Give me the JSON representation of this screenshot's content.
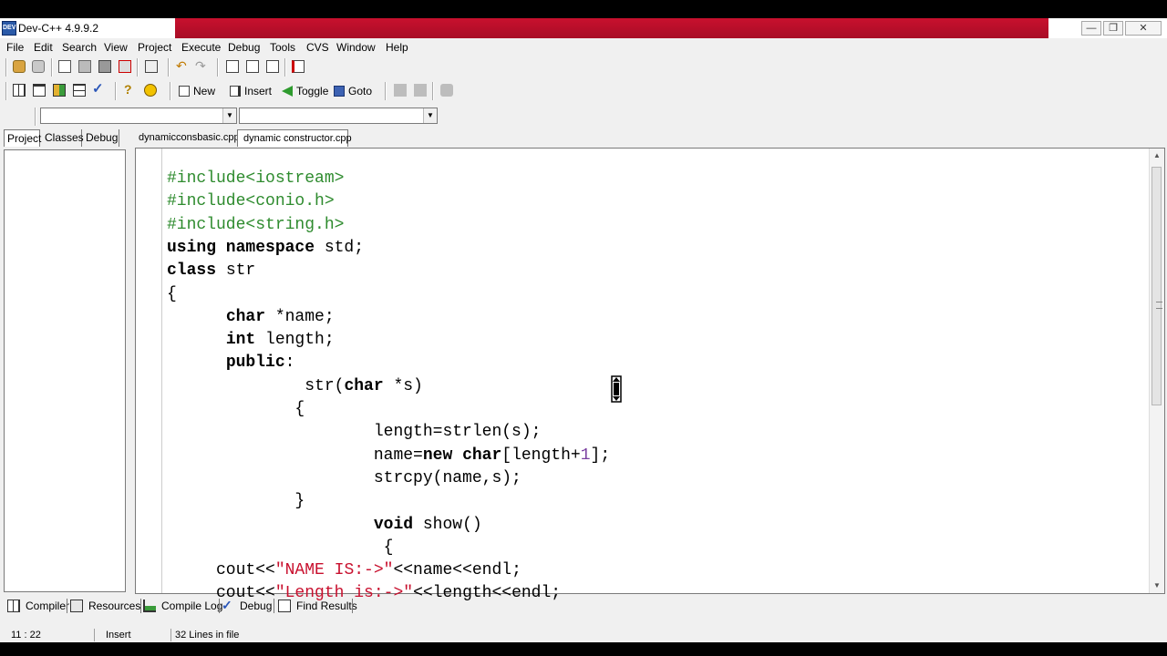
{
  "window": {
    "title": "Dev-C++ 4.9.9.2",
    "app_icon_text": "DEV"
  },
  "menu": [
    "File",
    "Edit",
    "Search",
    "View",
    "Project",
    "Execute",
    "Debug",
    "Tools",
    "CVS",
    "Window",
    "Help"
  ],
  "toolbar2": {
    "new_label": "New",
    "insert_label": "Insert",
    "toggle_label": "Toggle",
    "goto_label": "Goto"
  },
  "side_tabs": [
    "Project",
    "Classes",
    "Debug"
  ],
  "file_tabs": [
    "dynamicconsbasic.cpp",
    "dynamic constructor.cpp"
  ],
  "code_lines": [
    [
      {
        "t": "#include<iostream>",
        "c": "pp"
      }
    ],
    [
      {
        "t": "#include<conio.h>",
        "c": "pp"
      }
    ],
    [
      {
        "t": "#include<string.h>",
        "c": "pp"
      }
    ],
    [
      {
        "t": "using namespace",
        "c": "kw"
      },
      {
        "t": " std;",
        "c": ""
      }
    ],
    [
      {
        "t": "class",
        "c": "kw"
      },
      {
        "t": " str",
        "c": ""
      }
    ],
    [
      {
        "t": "{",
        "c": ""
      }
    ],
    [
      {
        "t": "      ",
        "c": ""
      },
      {
        "t": "char",
        "c": "kw"
      },
      {
        "t": " *name;",
        "c": ""
      }
    ],
    [
      {
        "t": "      ",
        "c": ""
      },
      {
        "t": "int",
        "c": "kw"
      },
      {
        "t": " length;",
        "c": ""
      }
    ],
    [
      {
        "t": "      ",
        "c": ""
      },
      {
        "t": "public",
        "c": "kw"
      },
      {
        "t": ":",
        "c": ""
      }
    ],
    [
      {
        "t": "              str(",
        "c": ""
      },
      {
        "t": "char",
        "c": "kw"
      },
      {
        "t": " *s)",
        "c": ""
      }
    ],
    [
      {
        "t": "             {",
        "c": ""
      }
    ],
    [
      {
        "t": "                     length=strlen(s);",
        "c": ""
      }
    ],
    [
      {
        "t": "                     name=",
        "c": ""
      },
      {
        "t": "new char",
        "c": "kw"
      },
      {
        "t": "[length+",
        "c": ""
      },
      {
        "t": "1",
        "c": "num"
      },
      {
        "t": "];",
        "c": ""
      }
    ],
    [
      {
        "t": "                     strcpy(name,s);",
        "c": ""
      }
    ],
    [
      {
        "t": "             }",
        "c": ""
      }
    ],
    [
      {
        "t": "                     ",
        "c": ""
      },
      {
        "t": "void",
        "c": "kw"
      },
      {
        "t": " show()",
        "c": ""
      }
    ],
    [
      {
        "t": "                      {",
        "c": ""
      }
    ],
    [
      {
        "t": "     cout<<",
        "c": ""
      },
      {
        "t": "\"NAME IS:->\"",
        "c": "str"
      },
      {
        "t": "<<name<<endl;",
        "c": ""
      }
    ],
    [
      {
        "t": "     cout<<",
        "c": ""
      },
      {
        "t": "\"Length is:->\"",
        "c": "str"
      },
      {
        "t": "<<length<<endl;",
        "c": ""
      }
    ]
  ],
  "bottom_tabs": [
    "Compiler",
    "Resources",
    "Compile Log",
    "Debug",
    "Find Results"
  ],
  "status": {
    "position": "11 : 22",
    "mode": "Insert",
    "lines": "32 Lines in file"
  },
  "colors": {
    "preprocessor": "#2e8b2e",
    "string": "#c8102e",
    "number": "#7a3fa0",
    "titlebar_red": "#c8102e"
  }
}
